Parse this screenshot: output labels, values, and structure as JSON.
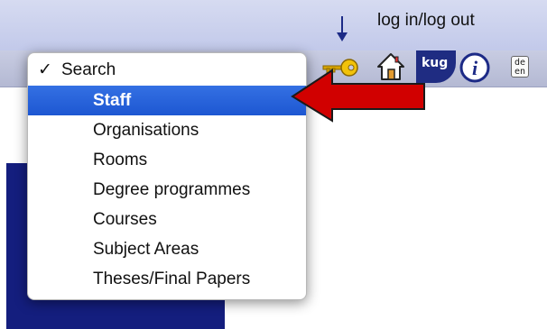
{
  "annotation": {
    "label": "log in/log out"
  },
  "toolbar": {
    "icons": [
      "key-icon",
      "home-icon",
      "kug-logo",
      "info-icon",
      "language-icon"
    ],
    "kug_text": "kug",
    "info_text": "i",
    "lang_top": "de",
    "lang_bottom": "en"
  },
  "background": {
    "letters": "in"
  },
  "dropdown": {
    "check_mark": "✓",
    "header": "Search",
    "items": [
      "Staff",
      "Organisations",
      "Rooms",
      "Degree programmes",
      "Courses",
      "Subject Areas",
      "Theses/Final Papers"
    ],
    "selected": "Staff"
  },
  "colors": {
    "selection": "#1f5bd6",
    "arrow_red": "#d10000",
    "logo_blue": "#1f2c82"
  }
}
